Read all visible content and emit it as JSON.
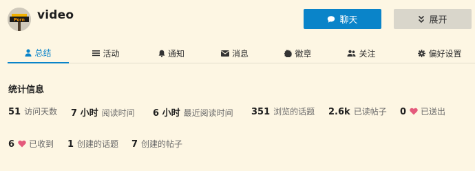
{
  "header": {
    "username": "video",
    "avatar_text": "Porn",
    "chat_label": "聊天",
    "expand_label": "展开"
  },
  "tabs": [
    {
      "label": "总结",
      "icon": "user-icon",
      "active": true
    },
    {
      "label": "活动",
      "icon": "list-icon",
      "active": false
    },
    {
      "label": "通知",
      "icon": "bell-icon",
      "active": false
    },
    {
      "label": "消息",
      "icon": "envelope-icon",
      "active": false
    },
    {
      "label": "徽章",
      "icon": "badge-icon",
      "active": false
    },
    {
      "label": "关注",
      "icon": "users-icon",
      "active": false
    },
    {
      "label": "偏好设置",
      "icon": "gear-icon",
      "active": false
    }
  ],
  "stats": {
    "title": "统计信息",
    "items": [
      {
        "value": "51",
        "label": "访问天数"
      },
      {
        "value": "7 小时",
        "label": "阅读时间"
      },
      {
        "value": "6 小时",
        "label": "最近阅读时间"
      },
      {
        "value": "351",
        "label": "浏览的话题"
      },
      {
        "value": "2.6k",
        "label": "已读帖子"
      },
      {
        "value": "0",
        "label": "已送出"
      },
      {
        "value": "6",
        "label": "已收到"
      },
      {
        "value": "1",
        "label": "创建的话题"
      },
      {
        "value": "7",
        "label": "创建的帖子"
      }
    ]
  },
  "colors": {
    "accent": "#0a84c9",
    "heart": "#e45a7c",
    "background": "#fdf6e3"
  }
}
